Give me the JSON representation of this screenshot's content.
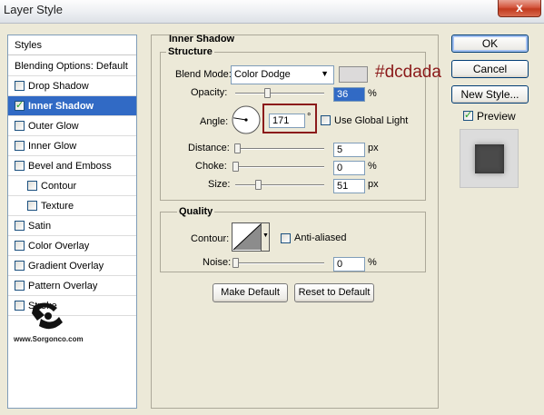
{
  "window": {
    "title": "Layer Style",
    "close_glyph": "x"
  },
  "styles": {
    "header": "Styles",
    "blending": "Blending Options: Default",
    "items": [
      {
        "label": "Drop Shadow",
        "checked": false
      },
      {
        "label": "Inner Shadow",
        "checked": true,
        "selected": true
      },
      {
        "label": "Outer Glow",
        "checked": false
      },
      {
        "label": "Inner Glow",
        "checked": false
      },
      {
        "label": "Bevel and Emboss",
        "checked": false
      },
      {
        "label": "Contour",
        "checked": false,
        "sub": true
      },
      {
        "label": "Texture",
        "checked": false,
        "sub": true
      },
      {
        "label": "Satin",
        "checked": false
      },
      {
        "label": "Color Overlay",
        "checked": false
      },
      {
        "label": "Gradient Overlay",
        "checked": false
      },
      {
        "label": "Pattern Overlay",
        "checked": false
      },
      {
        "label": "Stroke",
        "checked": false
      }
    ]
  },
  "inner_shadow": {
    "section_title": "Inner Shadow",
    "structure": {
      "title": "Structure",
      "blend_mode_label": "Blend Mode:",
      "blend_mode_value": "Color Dodge",
      "shadow_color": "#dcdada",
      "annotation": "#dcdada",
      "opacity_label": "Opacity:",
      "opacity_value": "36",
      "opacity_unit": "%",
      "angle_label": "Angle:",
      "angle_value": "171",
      "angle_unit": "°",
      "use_global_light_label": "Use Global Light",
      "use_global_light": false,
      "distance_label": "Distance:",
      "distance_value": "5",
      "distance_unit": "px",
      "choke_label": "Choke:",
      "choke_value": "0",
      "choke_unit": "%",
      "size_label": "Size:",
      "size_value": "51",
      "size_unit": "px"
    },
    "quality": {
      "title": "Quality",
      "contour_label": "Contour:",
      "anti_aliased_label": "Anti-aliased",
      "anti_aliased": false,
      "noise_label": "Noise:",
      "noise_value": "0",
      "noise_unit": "%"
    },
    "make_default": "Make Default",
    "reset_default": "Reset to Default"
  },
  "buttons": {
    "ok": "OK",
    "cancel": "Cancel",
    "new_style": "New Style...",
    "preview_label": "Preview",
    "preview_checked": true
  },
  "watermark": {
    "url": "www.Sorgonco.com"
  },
  "accent": {
    "annotation": "#8b1a1a",
    "selection": "#316ac5"
  }
}
